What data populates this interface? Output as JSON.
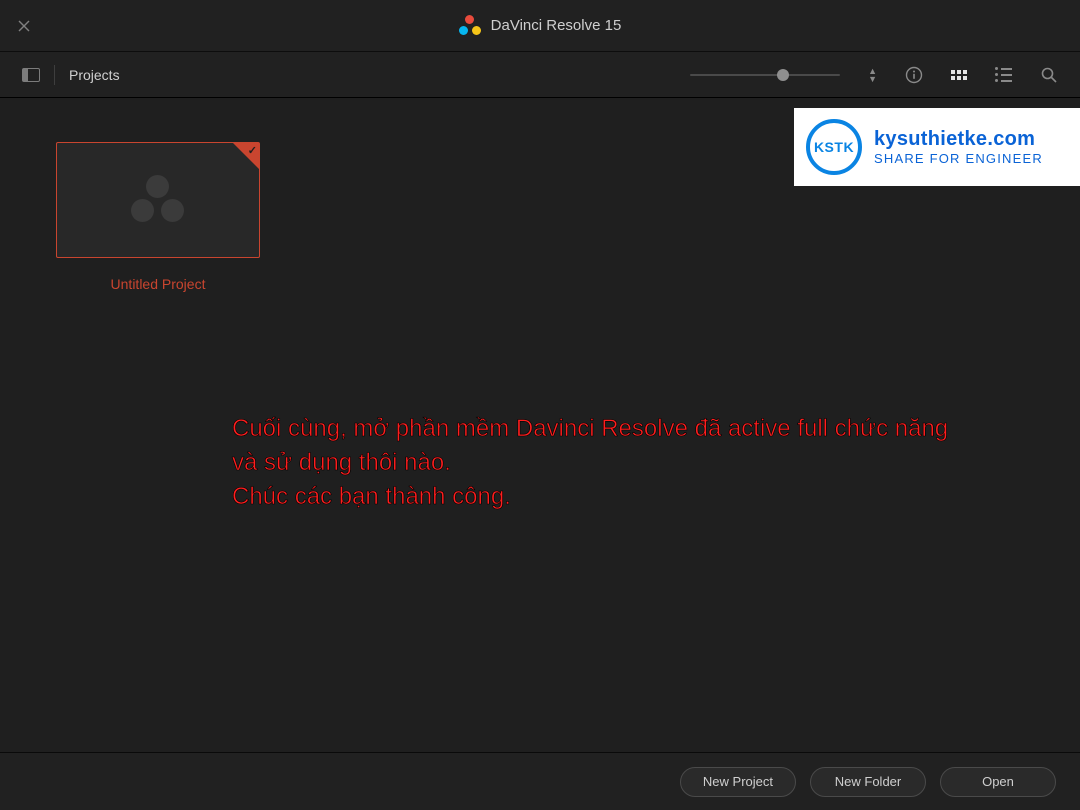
{
  "titlebar": {
    "app_name": "DaVinci Resolve 15"
  },
  "toolbar": {
    "breadcrumb": "Projects",
    "zoom": {
      "position_pct": 58
    }
  },
  "project": {
    "name": "Untitled Project",
    "selected": true
  },
  "watermark": {
    "badge": "KSTK",
    "line1": "kysuthietke.com",
    "line2": "SHARE FOR ENGINEER"
  },
  "overlay": {
    "line1": "Cuối cùng, mở phần mềm Davinci Resolve đã active full chức năng",
    "line2": "và sử dụng thôi nào.",
    "line3": "Chúc các bạn thành công."
  },
  "footer": {
    "new_project": "New Project",
    "new_folder": "New Folder",
    "open": "Open"
  }
}
